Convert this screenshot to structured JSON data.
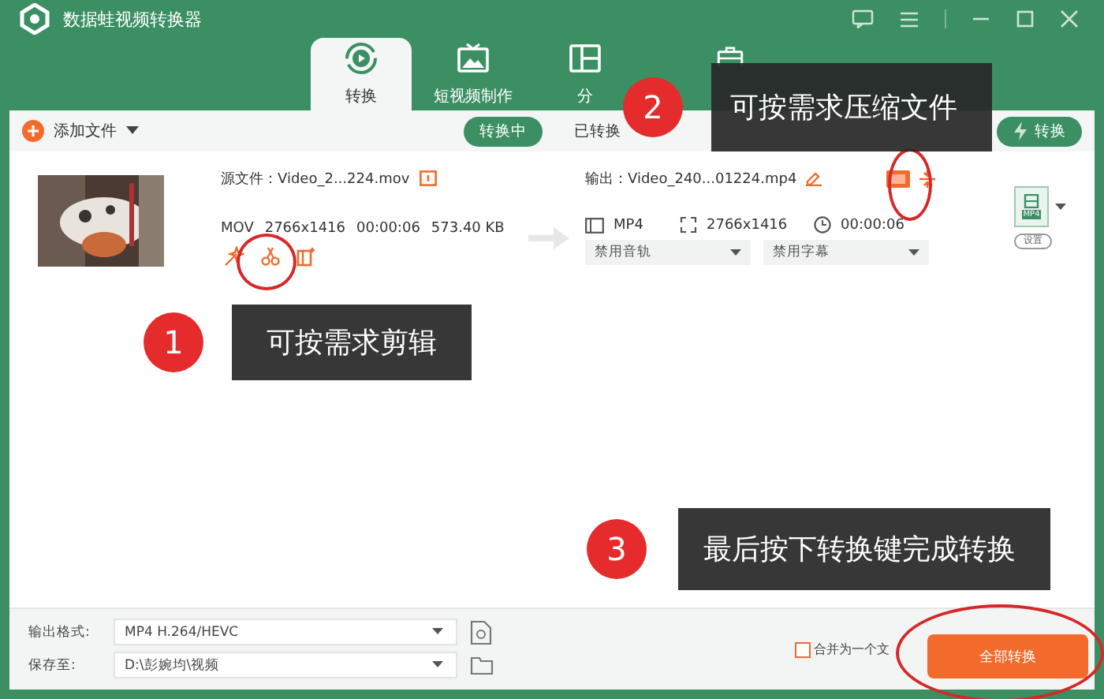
{
  "window": {
    "title": "数据蛙视频转换器"
  },
  "tabs": [
    {
      "kind": "convert",
      "label": "转换",
      "selected": true
    },
    {
      "kind": "short-video",
      "label": "短视频制作",
      "selected": false
    },
    {
      "kind": "split",
      "label": "分",
      "selected": false
    },
    {
      "kind": "toolbox",
      "selected": false
    }
  ],
  "toolbar": {
    "add_button": "添加文件",
    "filters": [
      {
        "label": "转换中",
        "selected": true
      },
      {
        "label": "已转换",
        "selected": false
      }
    ],
    "speed_button": "转换"
  },
  "file": {
    "source": "源文件：Video_2...224.mov",
    "meta": [
      "MOV",
      "2766x1416",
      "00:00:06",
      "573.40 KB"
    ],
    "output": "输出：Video_240...01224.mp4",
    "format": "MP4",
    "resolution": "2766x1416",
    "duration": "00:00:06",
    "audio": "禁用音轨",
    "subtitle": "禁用字幕",
    "format_badge": "MP4",
    "settings_button": "设置"
  },
  "bottom": {
    "format_label": "输出格式:",
    "format_value": "MP4 H.264/HEVC",
    "save_label": "保存至:",
    "save_value": "D:\\彭婉均\\视频",
    "merge": {
      "label": "合并为一个文",
      "checked": false
    },
    "convert_all": "全部转换"
  },
  "callouts": [
    {
      "number": "1",
      "text": "可按需求剪辑"
    },
    {
      "number": "2",
      "text": "可按需求压缩文件"
    },
    {
      "number": "3",
      "text": "最后按下转换键完成转换"
    }
  ]
}
